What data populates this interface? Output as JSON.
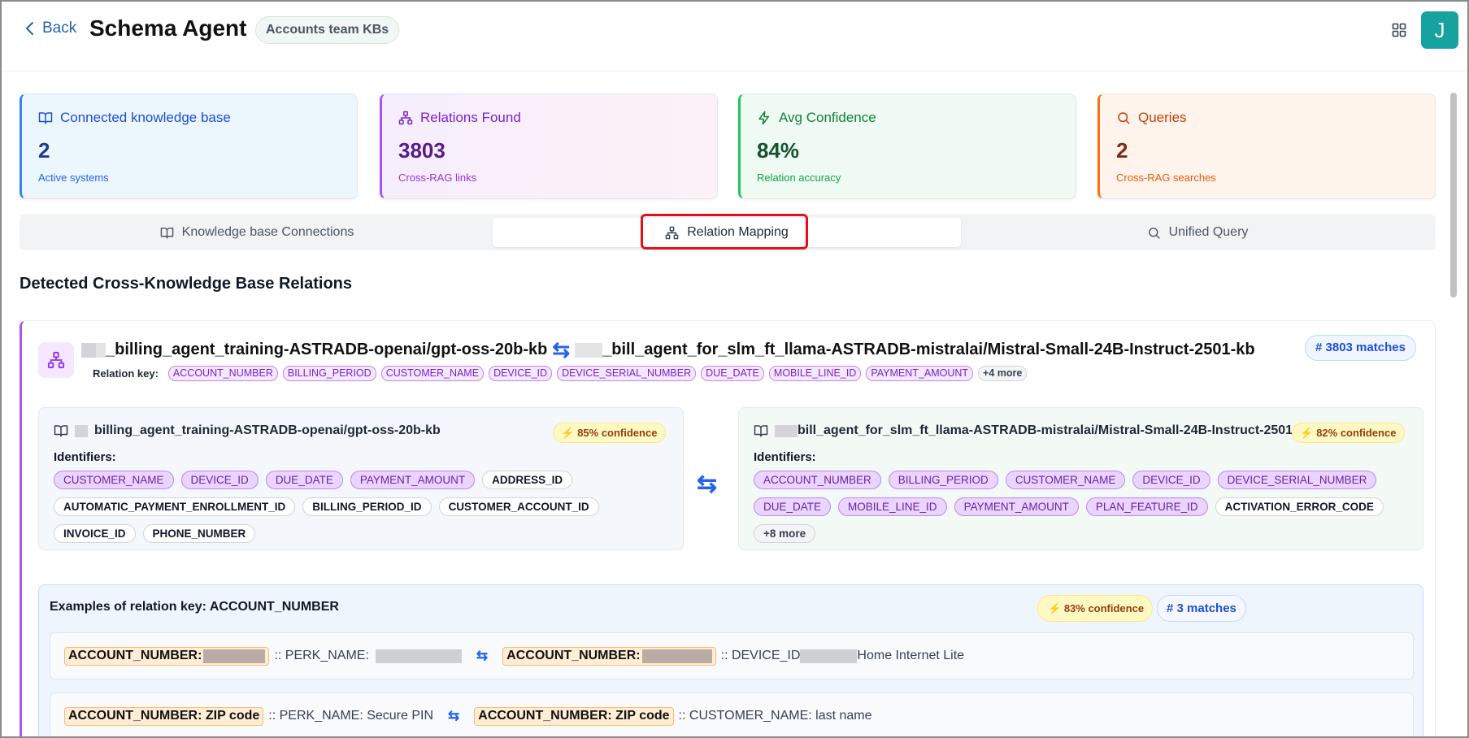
{
  "header": {
    "back_label": "Back",
    "title": "Schema Agent",
    "badge": "Accounts team KBs",
    "avatar_letter": "J"
  },
  "stats": [
    {
      "title": "Connected knowledge base",
      "value": "2",
      "sub": "Active systems",
      "icon": "book-open-icon",
      "color": "#3b82f6"
    },
    {
      "title": "Relations Found",
      "value": "3803",
      "sub": "Cross-RAG links",
      "icon": "network-icon",
      "color": "#a855f7"
    },
    {
      "title": "Avg Confidence",
      "value": "84%",
      "sub": "Relation accuracy",
      "icon": "lightning-icon",
      "color": "#22c55e"
    },
    {
      "title": "Queries",
      "value": "2",
      "sub": "Cross-RAG searches",
      "icon": "search-icon",
      "color": "#f97316"
    }
  ],
  "tabs": [
    {
      "label": "Knowledge base Connections",
      "icon": "book-open-icon"
    },
    {
      "label": "Relation Mapping",
      "icon": "network-icon",
      "active": true
    },
    {
      "label": "Unified Query",
      "icon": "search-icon"
    }
  ],
  "section_title": "Detected Cross-Knowledge Base Relations",
  "relation": {
    "left_kb": "_billing_agent_training-ASTRADB-openai/gpt-oss-20b-kb",
    "right_kb": "_bill_agent_for_slm_ft_llama-ASTRADB-mistralai/Mistral-Small-24B-Instruct-2501-kb",
    "matches": "# 3803 matches",
    "relation_key_label": "Relation key:",
    "relation_keys": [
      "ACCOUNT_NUMBER",
      "BILLING_PERIOD",
      "CUSTOMER_NAME",
      "DEVICE_ID",
      "DEVICE_SERIAL_NUMBER",
      "DUE_DATE",
      "MOBILE_LINE_ID",
      "PAYMENT_AMOUNT"
    ],
    "relation_keys_more": "+4 more"
  },
  "kb_left": {
    "title": "billing_agent_training-ASTRADB-openai/gpt-oss-20b-kb",
    "confidence": "85% confidence",
    "identifiers_label": "Identifiers:",
    "matched": [
      "CUSTOMER_NAME",
      "DEVICE_ID",
      "DUE_DATE",
      "PAYMENT_AMOUNT"
    ],
    "other": [
      "ADDRESS_ID",
      "AUTOMATIC_PAYMENT_ENROLLMENT_ID",
      "BILLING_PERIOD_ID",
      "CUSTOMER_ACCOUNT_ID",
      "INVOICE_ID",
      "PHONE_NUMBER"
    ]
  },
  "kb_right": {
    "title": "bill_agent_for_slm_ft_llama-ASTRADB-mistralai/Mistral-Small-24B-Instruct-2501-k",
    "confidence": "82% confidence",
    "identifiers_label": "Identifiers:",
    "matched": [
      "ACCOUNT_NUMBER",
      "BILLING_PERIOD",
      "CUSTOMER_NAME",
      "DEVICE_ID",
      "DEVICE_SERIAL_NUMBER",
      "DUE_DATE",
      "MOBILE_LINE_ID",
      "PAYMENT_AMOUNT",
      "PLAN_FEATURE_ID"
    ],
    "other": [
      "ACTIVATION_ERROR_CODE"
    ],
    "more": "+8 more"
  },
  "examples": {
    "title": "Examples of relation key: ACCOUNT_NUMBER",
    "confidence": "83% confidence",
    "matches": "# 3 matches",
    "rows": [
      {
        "left_key": "ACCOUNT_NUMBER:",
        "left_rest": ":: PERK_NAME:",
        "right_key": "ACCOUNT_NUMBER:",
        "right_rest": ":: DEVICE_ID",
        "right_tail": "Home Internet Lite"
      },
      {
        "left_key": "ACCOUNT_NUMBER: ZIP code",
        "left_rest": ":: PERK_NAME: Secure PIN",
        "right_key": "ACCOUNT_NUMBER: ZIP code",
        "right_rest": ":: CUSTOMER_NAME: last name",
        "right_tail": ""
      }
    ]
  }
}
